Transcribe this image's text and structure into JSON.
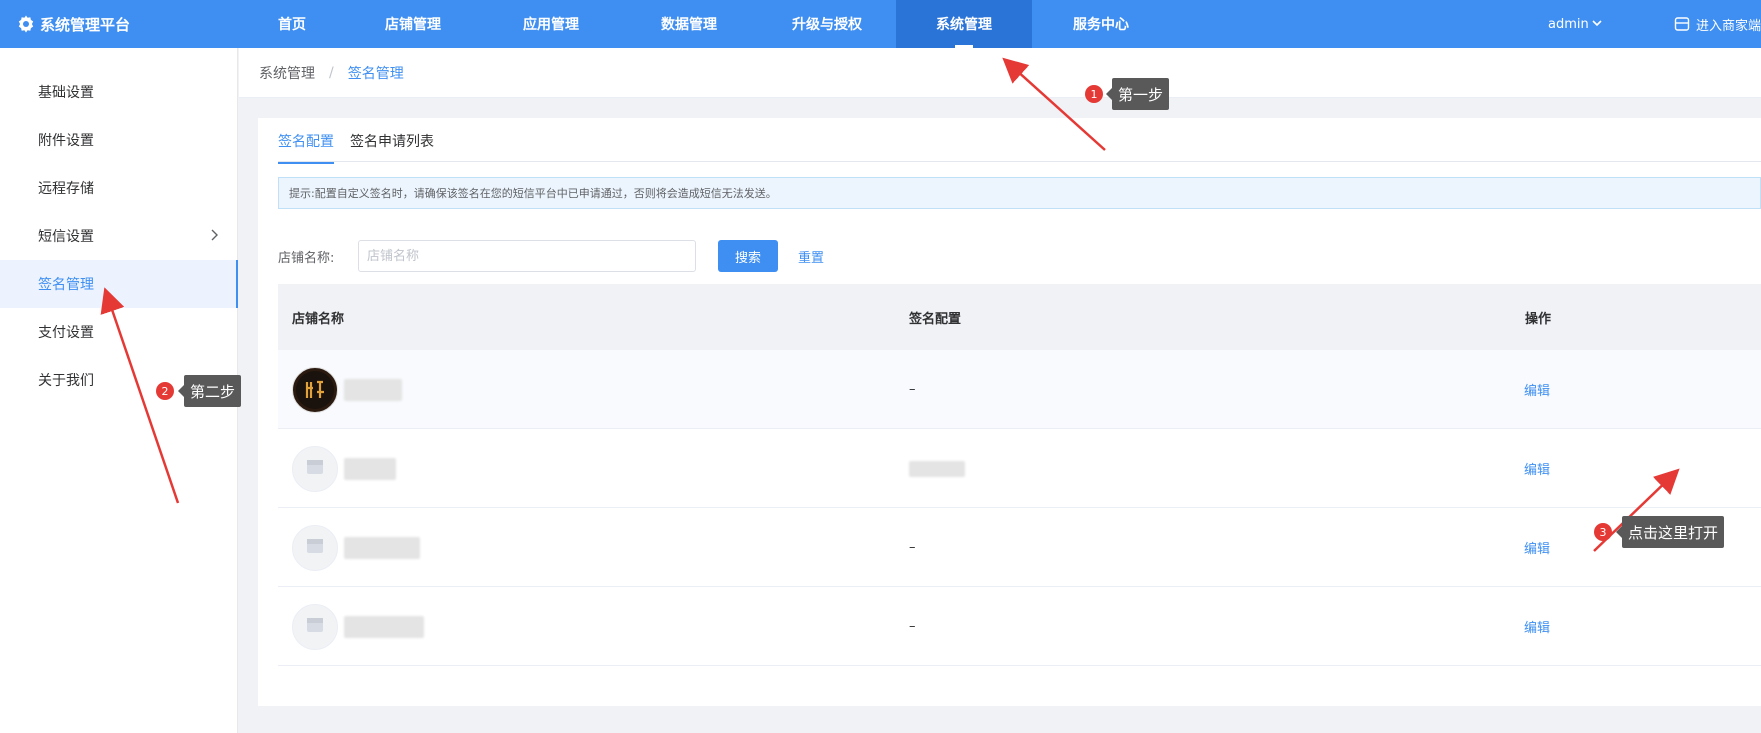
{
  "app": {
    "title": "系统管理平台"
  },
  "nav": {
    "items": [
      "首页",
      "店铺管理",
      "应用管理",
      "数据管理",
      "升级与授权",
      "系统管理",
      "服务中心"
    ],
    "active_index": 5,
    "user": "admin",
    "merchant_link": "进入商家端"
  },
  "sidebar": {
    "items": [
      "基础设置",
      "附件设置",
      "远程存储",
      "短信设置",
      "签名管理",
      "支付设置",
      "关于我们"
    ],
    "active_index": 4
  },
  "breadcrumb": {
    "parent": "系统管理",
    "separator": "/",
    "current": "签名管理"
  },
  "tabs": [
    "签名配置",
    "签名申请列表"
  ],
  "tip": "提示:配置自定义签名时，请确保该签名在您的短信平台中已申请通过，否则将会造成短信无法发送。",
  "search": {
    "label": "店铺名称:",
    "placeholder": "店铺名称",
    "search_button": "搜索",
    "reset_link": "重置"
  },
  "table": {
    "columns": [
      "店铺名称",
      "签名配置",
      "操作"
    ],
    "rows": [
      {
        "shop_name": "",
        "signature": "–",
        "action": "编辑"
      },
      {
        "shop_name": "",
        "signature": "",
        "action": "编辑"
      },
      {
        "shop_name": "",
        "signature": "–",
        "action": "编辑"
      },
      {
        "shop_name": "",
        "signature": "–",
        "action": "编辑"
      }
    ]
  },
  "annotations": [
    {
      "number": "1",
      "text": "第一步"
    },
    {
      "number": "2",
      "text": "第二步"
    },
    {
      "number": "3",
      "text": "点击这里打开"
    }
  ],
  "colors": {
    "primary": "#3f8ff2",
    "annotation_red": "#e53935",
    "callout_bg": "#595959"
  }
}
